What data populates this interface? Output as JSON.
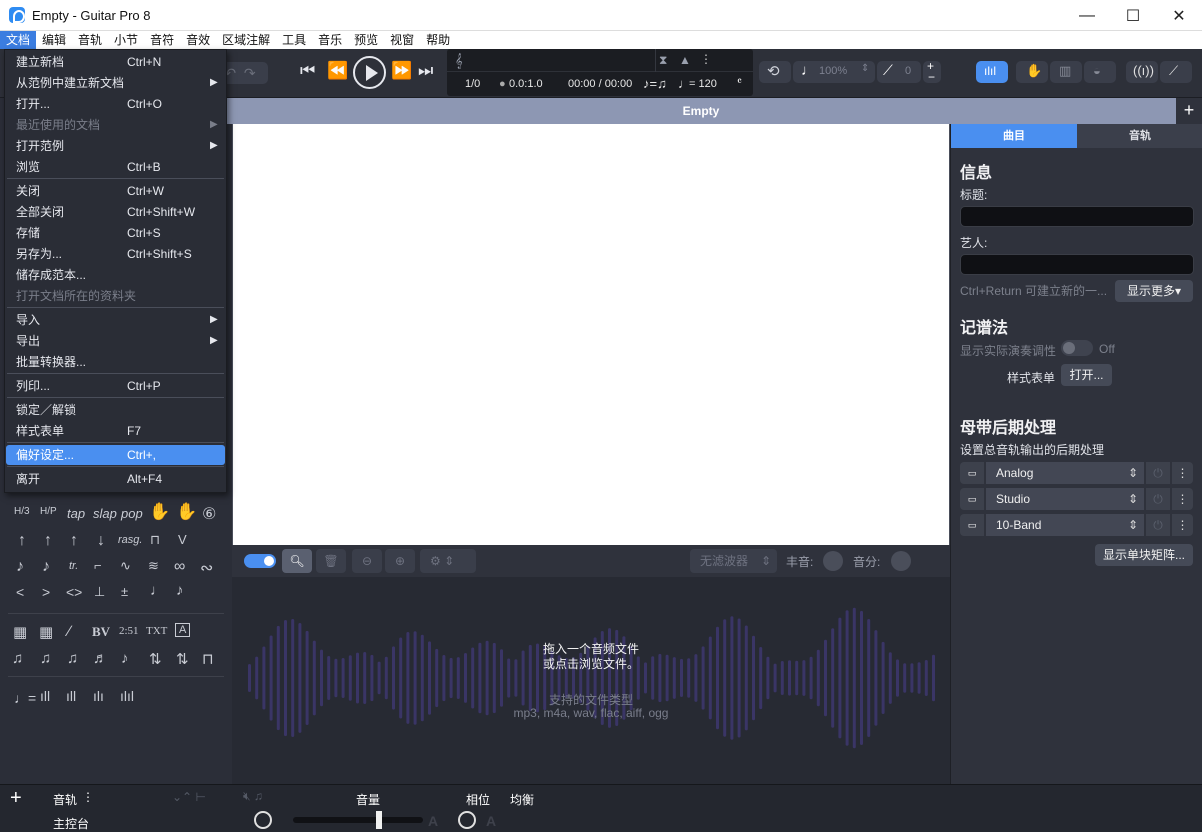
{
  "window": {
    "title": "Empty - Guitar Pro 8",
    "minimize": "—",
    "maximize": "☐",
    "close": "✕"
  },
  "menubar": [
    "文档",
    "编辑",
    "音轨",
    "小节",
    "音符",
    "音效",
    "区域注解",
    "工具",
    "音乐",
    "预览",
    "视窗",
    "帮助"
  ],
  "file_menu": [
    {
      "label": "建立新档",
      "shortcut": "Ctrl+N"
    },
    {
      "label": "从范例中建立新文档",
      "shortcut": "",
      "submenu": true
    },
    {
      "label": "打开...",
      "shortcut": "Ctrl+O"
    },
    {
      "label": "最近使用的文档",
      "shortcut": "",
      "submenu": true,
      "disabled": true
    },
    {
      "label": "打开范例",
      "shortcut": "",
      "submenu": true
    },
    {
      "label": "浏览",
      "shortcut": "Ctrl+B"
    },
    {
      "label": "关闭",
      "shortcut": "Ctrl+W"
    },
    {
      "label": "全部关闭",
      "shortcut": "Ctrl+Shift+W"
    },
    {
      "label": "存储",
      "shortcut": "Ctrl+S"
    },
    {
      "label": "另存为...",
      "shortcut": "Ctrl+Shift+S"
    },
    {
      "label": "储存成范本...",
      "shortcut": ""
    },
    {
      "label": "打开文档所在的资料夹",
      "shortcut": "",
      "disabled": true
    },
    {
      "label": "导入",
      "shortcut": "",
      "submenu": true
    },
    {
      "label": "导出",
      "shortcut": "",
      "submenu": true
    },
    {
      "label": "批量转换器...",
      "shortcut": ""
    },
    {
      "label": "列印...",
      "shortcut": "Ctrl+P"
    },
    {
      "label": "锁定／解锁",
      "shortcut": ""
    },
    {
      "label": "样式表单",
      "shortcut": "F7"
    },
    {
      "label": "偏好设定...",
      "shortcut": "Ctrl+,",
      "highlighted": true
    },
    {
      "label": "离开",
      "shortcut": "Alt+F4"
    }
  ],
  "lcd": {
    "bar": "1/0",
    "position": "0.0:1.0",
    "time": "00:00 / 00:00",
    "tempo_label": "= 120",
    "swing": "= "
  },
  "toolbar": {
    "speed": "100%",
    "tuning": "0"
  },
  "score": {
    "tab_title": "Empty",
    "add": "+"
  },
  "audio": {
    "filter_label": "无滤波器",
    "pan_label": "丰音:",
    "gain_label": "音分:",
    "drop_line1": "拖入一个音频文件",
    "drop_line2": "或点击浏览文件。",
    "supported_title": "支持的文件类型",
    "supported_types": "mp3, m4a, wav, flac, aiff, ogg"
  },
  "right": {
    "tab_song": "曲目",
    "tab_track": "音轨",
    "info_title": "信息",
    "title_label": "标题:",
    "artist_label": "艺人:",
    "hint": "Ctrl+Return 可建立新的一...",
    "show_more": "显示更多▾",
    "notation_title": "记谱法",
    "show_transposing": "显示实际演奏调性",
    "toggle_off": "Off",
    "stylesheet_label": "样式表单",
    "open_button": "打开...",
    "master_title": "母带后期处理",
    "master_desc": "设置总音轨输出的后期处理",
    "effects": [
      "Analog",
      "Studio",
      "10-Band"
    ],
    "matrix_button": "显示单块矩阵..."
  },
  "bottom": {
    "add": "+",
    "track_label": "音轨",
    "master_label": "主控台",
    "volume_label": "音量",
    "phase_label": "相位",
    "balance_label": "均衡"
  },
  "colors": {
    "accent": "#4a8ff0",
    "menu_active": "#3b7de0"
  }
}
